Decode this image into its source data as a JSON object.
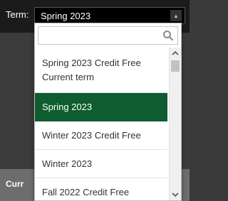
{
  "header": {
    "term_label": "Term:",
    "selected_term": "Spring 2023"
  },
  "dropdown": {
    "search_value": "",
    "options": [
      {
        "lines": [
          "Spring 2023 Credit Free",
          "Current term"
        ]
      },
      {
        "label": "Spring 2023",
        "selected": true
      },
      {
        "label": "Winter 2023 Credit Free"
      },
      {
        "label": "Winter 2023"
      },
      {
        "label": "Fall 2022 Credit Free"
      }
    ]
  },
  "bottom": {
    "label": "Curr"
  },
  "colors": {
    "selected_bg": "#0e5c2f",
    "topbar_bg": "#1b1b1b",
    "bottom_bar_bg": "#6d6d6d"
  },
  "icons": [
    "search-icon",
    "caret-up-icon",
    "scroll-up-icon",
    "scroll-down-icon"
  ]
}
